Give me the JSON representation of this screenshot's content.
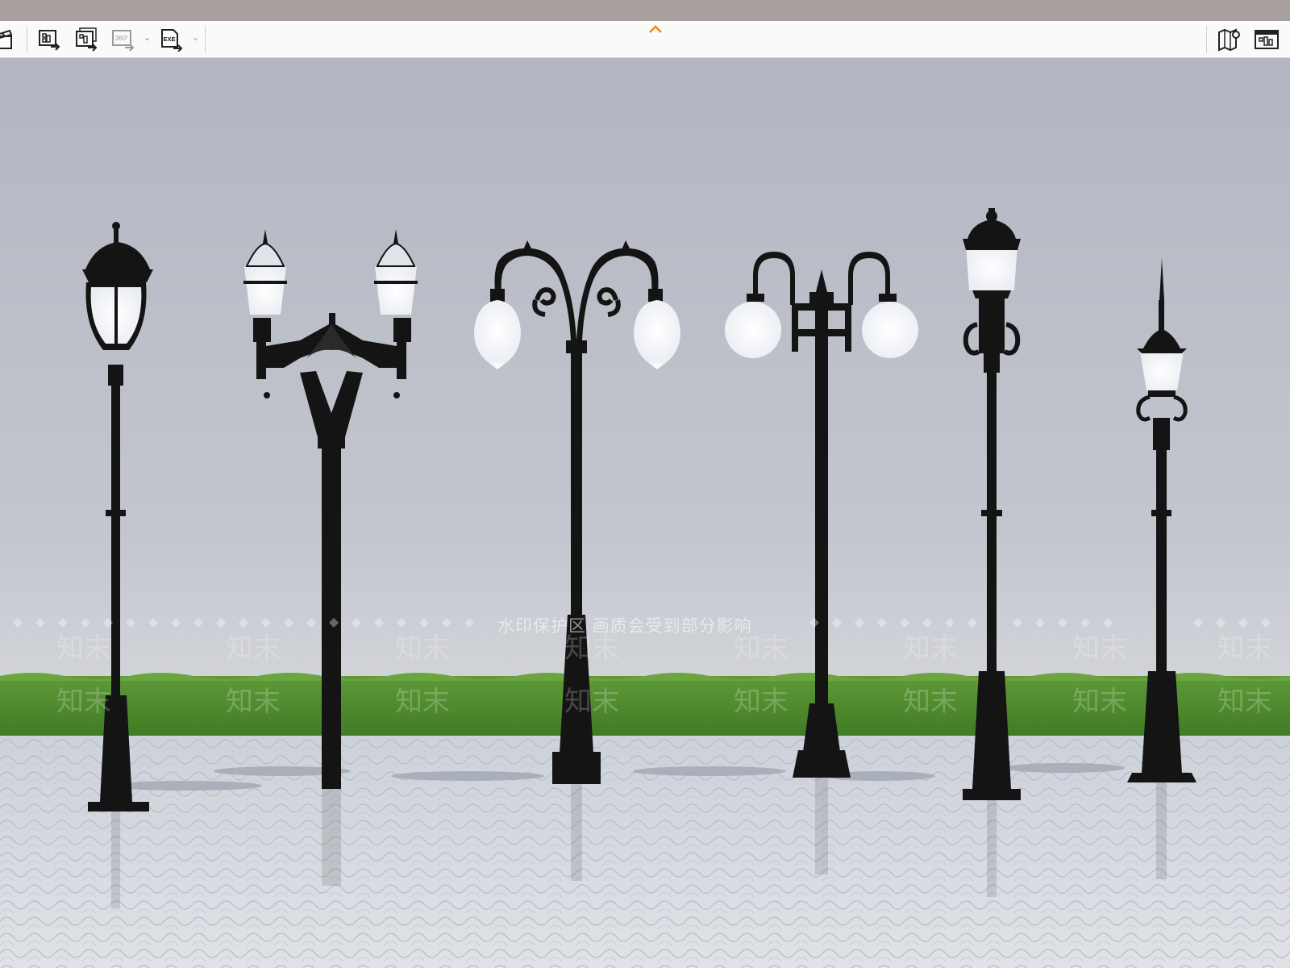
{
  "toolbar": {
    "left_tools": [
      {
        "name": "clapper-icon"
      },
      {
        "name": "render-image-icon"
      },
      {
        "name": "batch-render-icon"
      },
      {
        "name": "panorama-360-icon",
        "label": "360°"
      },
      {
        "name": "export-exe-icon",
        "label": "EXE"
      }
    ],
    "right_tools": [
      {
        "name": "map-location-icon"
      },
      {
        "name": "screen-layout-icon"
      }
    ],
    "accent": "#f08a00"
  },
  "viewport": {
    "watermark_text": "水印保护区  画质会受到部分影响",
    "watermark_mark": "知末",
    "sky_color": "#b9bcc6",
    "grass_color": "#4f8a2f",
    "pavement_color": "#d6d9df"
  }
}
